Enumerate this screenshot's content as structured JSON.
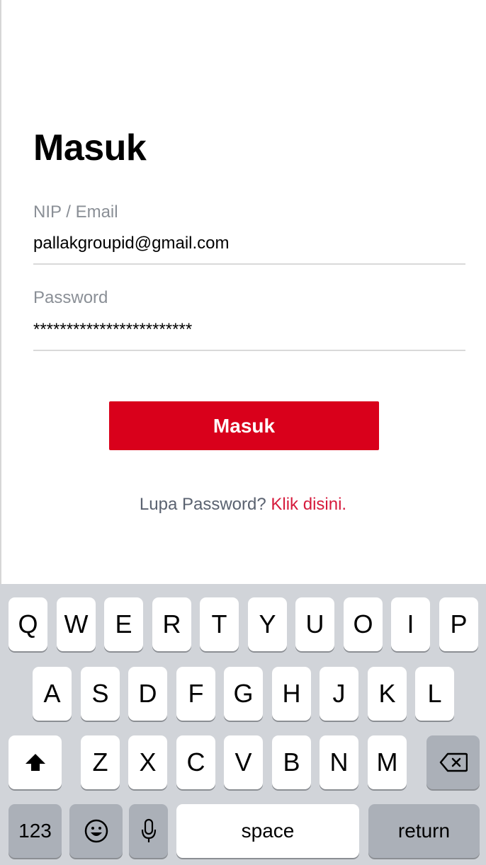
{
  "page": {
    "title": "Masuk"
  },
  "form": {
    "email_label": "NIP / Email",
    "email_value": "pallakgroupid@gmail.com",
    "password_label": "Password",
    "password_value": "************************",
    "submit_label": "Masuk",
    "forgot_question": "Lupa Password?",
    "forgot_link": "Klik disini."
  },
  "colors": {
    "accent": "#d9001b",
    "link": "#d61a3c",
    "label": "#8a8f96",
    "keyboard_bg": "#d1d4d9"
  },
  "keyboard": {
    "row1": [
      "Q",
      "W",
      "E",
      "R",
      "T",
      "Y",
      "U",
      "O",
      "I",
      "P"
    ],
    "row2": [
      "A",
      "S",
      "D",
      "F",
      "G",
      "H",
      "J",
      "K",
      "L"
    ],
    "row3": [
      "Z",
      "X",
      "C",
      "V",
      "B",
      "N",
      "M"
    ],
    "numbers_label": "123",
    "space_label": "space",
    "return_label": "return",
    "icons": [
      "shift-icon",
      "backspace-icon",
      "emoji-icon",
      "microphone-icon"
    ]
  }
}
